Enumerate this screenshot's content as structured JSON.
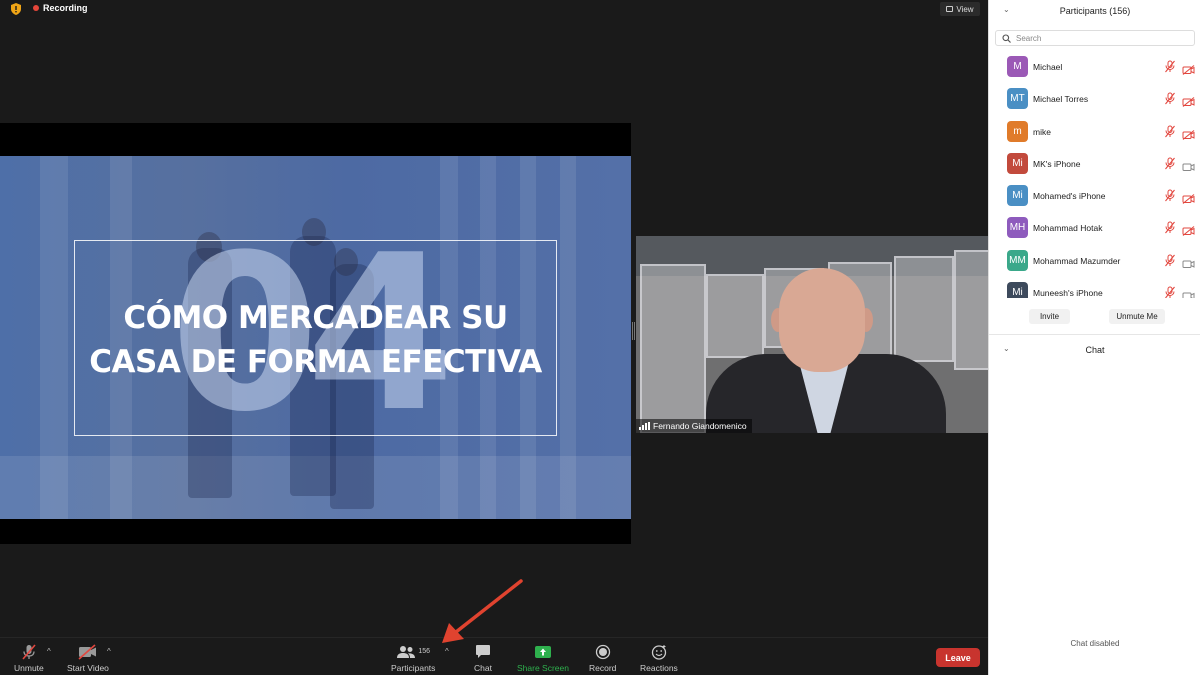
{
  "topbar": {
    "recording_label": "Recording",
    "view_label": "View"
  },
  "slide": {
    "big_number": "04",
    "title_line1": "CÓMO MERCADEAR SU",
    "title_line2": "CASA DE FORMA EFECTIVA"
  },
  "video": {
    "name": "Fernando Giandomenico"
  },
  "toolbar": {
    "unmute_label": "Unmute",
    "start_video_label": "Start Video",
    "participants_label": "Participants",
    "participants_count": "156",
    "chat_label": "Chat",
    "share_screen_label": "Share Screen",
    "record_label": "Record",
    "reactions_label": "Reactions",
    "leave_label": "Leave"
  },
  "participants_panel": {
    "title": "Participants (156)",
    "search_placeholder": "Search",
    "participants": [
      {
        "initials": "M",
        "name": "Michael",
        "color": "#9b59b6",
        "mic": "muted",
        "video": "off"
      },
      {
        "initials": "MT",
        "name": "Michael Torres",
        "color": "#4a8fc4",
        "mic": "muted",
        "video": "off"
      },
      {
        "initials": "m",
        "name": "mike",
        "color": "#e07b2a",
        "mic": "muted",
        "video": "off"
      },
      {
        "initials": "Mi",
        "name": "MK's iPhone",
        "color": "#c24a3c",
        "mic": "muted",
        "video": "on"
      },
      {
        "initials": "Mi",
        "name": "Mohamed's iPhone",
        "color": "#4a8fc4",
        "mic": "muted",
        "video": "off"
      },
      {
        "initials": "MH",
        "name": "Mohammad Hotak",
        "color": "#8e5bbd",
        "mic": "muted",
        "video": "off"
      },
      {
        "initials": "MM",
        "name": "Mohammad Mazumder",
        "color": "#3aa88a",
        "mic": "muted",
        "video": "on"
      },
      {
        "initials": "Mi",
        "name": "Muneesh's iPhone",
        "color": "#3d4a5c",
        "mic": "muted",
        "video": "on"
      }
    ],
    "invite_label": "Invite",
    "unmute_me_label": "Unmute Me"
  },
  "chat_panel": {
    "title": "Chat",
    "disabled_text": "Chat disabled"
  },
  "colors": {
    "leave": "#c8342e",
    "share_screen": "#2eb04d",
    "muted": "#e2473f",
    "recording": "#e5463a"
  }
}
